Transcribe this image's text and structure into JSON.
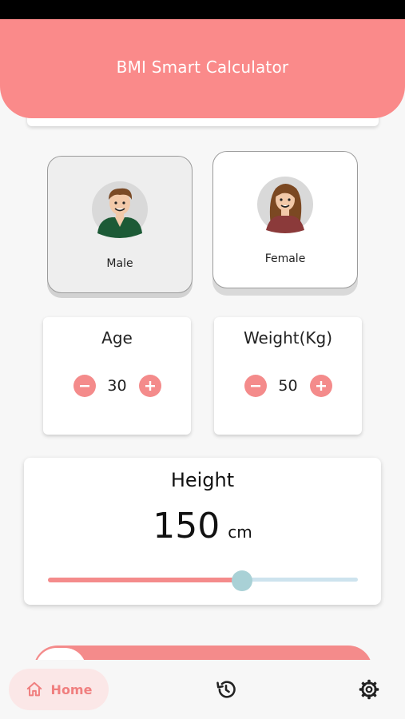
{
  "app": {
    "title": "BMI Smart Calculator"
  },
  "gender": {
    "male": {
      "label": "Male",
      "icon": "male-avatar-icon"
    },
    "female": {
      "label": "Female",
      "icon": "female-avatar-icon"
    },
    "selected": "Male"
  },
  "age": {
    "title": "Age",
    "value": "30",
    "minus_icon": "minus-icon",
    "plus_icon": "plus-icon"
  },
  "weight": {
    "title": "Weight(Kg)",
    "value": "50",
    "minus_icon": "minus-icon",
    "plus_icon": "plus-icon"
  },
  "height": {
    "title": "Height",
    "value": "150",
    "unit": "cm",
    "slider_fraction": 0.62
  },
  "nav": {
    "home_label": "Home",
    "home_icon": "home-icon",
    "history_icon": "history-icon",
    "settings_icon": "gear-icon"
  },
  "colors": {
    "accent": "#fa8a8a",
    "button": "#f48b8b",
    "slider_thumb": "#a9d1d6",
    "slider_track_rest": "#cde3ee",
    "home_pill": "#fbe7e7"
  }
}
